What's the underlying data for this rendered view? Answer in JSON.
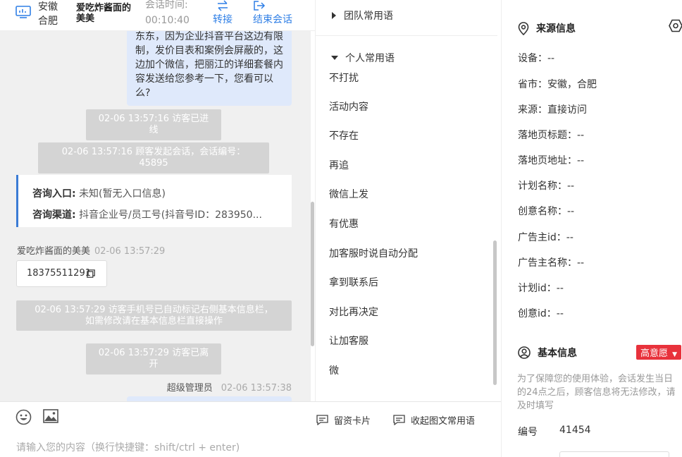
{
  "header": {
    "location": "安徽合肥",
    "visitor_name": "爱吃炸酱面的美美",
    "session_time_label": "会话时间:",
    "session_time": "00:10:40",
    "transfer_label": "转接",
    "end_label": "结束会话"
  },
  "chat": {
    "my_bubble_text": "东东，因为企业抖音平台这边有限制，发价目表和案例会屏蔽的，这边加个微信，把丽江的详细套餐内容发送给您参考一下，您看可以么?",
    "sys_visitor_enter": "02-06 13:57:16 访客已进线",
    "sys_session_start": "02-06 13:57:16 顾客发起会话，会话编号：45895",
    "entry_label": "咨询入口:",
    "entry_value": "未知(暂无入口信息)",
    "channel_label": "咨询渠道:",
    "channel_value": "抖音企业号/员工号(抖音号ID：283950...",
    "visitor_sender": "爱吃炸酱面的美美",
    "visitor_ts": "02-06 13:57:29",
    "phone": "18375511291",
    "sys_phone_line1": "02-06 13:57:29 访客手机号已自动标记右侧基本信息栏，",
    "sys_phone_line2": "如需修改请在基本信息栏直接操作",
    "sys_visitor_left": "02-06 13:57:29 访客已离开",
    "admin_sender": "超级管理员",
    "admin_ts": "02-06 13:57:38"
  },
  "input": {
    "placeholder": "请输入您的内容（换行快捷键：shift/ctrl + enter)",
    "card_label": "留资卡片",
    "collapse_label": "收起图文常用语"
  },
  "phrases": {
    "team_group": "团队常用语",
    "personal_group": "个人常用语",
    "items": [
      "不打扰",
      "活动内容",
      "不存在",
      "再追",
      "微信上发",
      "有优惠",
      "加客服时说自动分配",
      "拿到联系后",
      "对比再决定",
      "让加客服",
      "微"
    ]
  },
  "side": {
    "source_title": "来源信息",
    "fields": [
      {
        "label": "设备：",
        "value": "--"
      },
      {
        "label": "省市：",
        "value": "安徽，合肥"
      },
      {
        "label": "来源：",
        "value": "直接访问"
      },
      {
        "label": "落地页标题：",
        "value": "--"
      },
      {
        "label": "落地页地址：",
        "value": "--"
      },
      {
        "label": "计划名称：",
        "value": "--"
      },
      {
        "label": "创意名称：",
        "value": "--"
      },
      {
        "label": "广告主id：",
        "value": "--"
      },
      {
        "label": "广告主名称：",
        "value": "--"
      },
      {
        "label": "计划id：",
        "value": "--"
      },
      {
        "label": "创意id：",
        "value": "--"
      }
    ],
    "basic_title": "基本信息",
    "intent_tag": "高意愿",
    "note": "为了保障您的使用体验，会话发生当日的24点之后，顾客信息将无法修改，请及时填写",
    "id_label": "编号",
    "id_value": "41454"
  },
  "colors": {
    "accent": "#2f7fe6",
    "bubble": "#dfe9fb",
    "system": "#d4d4d4",
    "tag": "#e8323c"
  }
}
